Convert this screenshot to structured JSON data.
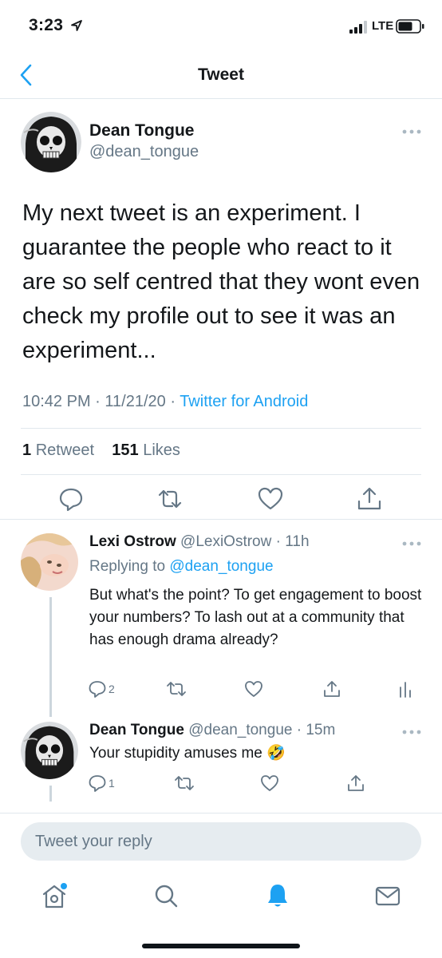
{
  "status_bar": {
    "time": "3:23",
    "network": "LTE"
  },
  "header": {
    "title": "Tweet"
  },
  "tweet": {
    "author_name": "Dean Tongue",
    "author_handle": "@dean_tongue",
    "text": "My next tweet is an experiment. I guarantee the people who react to it are so self centred that they wont even check my profile out to see it was an experiment...",
    "time": "10:42 PM",
    "date": "11/21/20",
    "source": "Twitter for Android",
    "retweet_count": "1",
    "retweet_label": "Retweet",
    "like_count": "151",
    "like_label": "Likes"
  },
  "replies": [
    {
      "author_name": "Lexi Ostrow",
      "author_handle": "@LexiOstrow",
      "age": "11h",
      "replying_to_label": "Replying to",
      "replying_to": "@dean_tongue",
      "text": "But what's the point? To get engagement to boost your numbers? To lash out at a community that has enough drama already?",
      "reply_count": "2"
    },
    {
      "author_name": "Dean Tongue",
      "author_handle": "@dean_tongue",
      "age": "15m",
      "text": "Your stupidity amuses me",
      "emoji": "🤣",
      "reply_count": "1"
    }
  ],
  "composer": {
    "placeholder": "Tweet your reply"
  },
  "colors": {
    "accent": "#1da1f2",
    "secondary_text": "#657786",
    "divider": "#e1e8ed"
  },
  "icons": [
    "back-chevron-icon",
    "more-icon",
    "reply-icon",
    "retweet-icon",
    "like-icon",
    "share-icon",
    "analytics-icon",
    "home-icon",
    "search-icon",
    "notifications-icon",
    "messages-icon"
  ]
}
